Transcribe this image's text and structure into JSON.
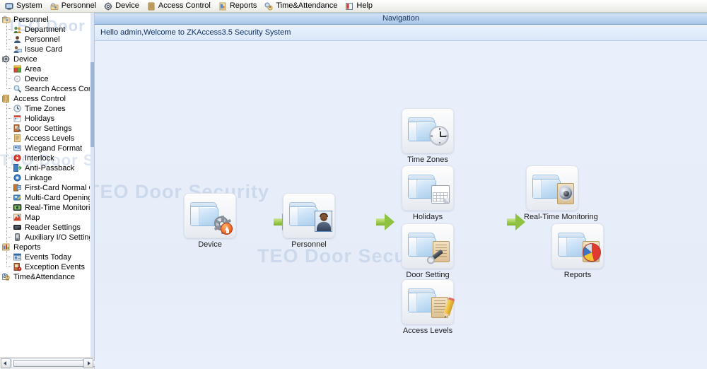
{
  "app": {
    "watermark": "TEO Door Security"
  },
  "menubar": {
    "items": [
      {
        "label": "System",
        "icon": "monitor-icon"
      },
      {
        "label": "Personnel",
        "icon": "personnel-icon"
      },
      {
        "label": "Device",
        "icon": "gear-icon"
      },
      {
        "label": "Access Control",
        "icon": "door-icon"
      },
      {
        "label": "Reports",
        "icon": "report-icon"
      },
      {
        "label": "Time&Attendance",
        "icon": "clock-people-icon"
      },
      {
        "label": "Help",
        "icon": "help-book-icon"
      }
    ]
  },
  "sidebar": {
    "nodes": [
      {
        "label": "Personnel",
        "level": 0,
        "icon": "personnel-folder-icon",
        "expanded": true
      },
      {
        "label": "Department",
        "level": 1,
        "icon": "department-icon"
      },
      {
        "label": "Personnel",
        "level": 1,
        "icon": "person-icon"
      },
      {
        "label": "Issue Card",
        "level": 1,
        "icon": "issue-card-icon"
      },
      {
        "label": "Device",
        "level": 0,
        "icon": "gear-icon",
        "expanded": true
      },
      {
        "label": "Area",
        "level": 1,
        "icon": "area-icon"
      },
      {
        "label": "Device",
        "level": 1,
        "icon": "device-gear-icon"
      },
      {
        "label": "Search Access Contro",
        "level": 1,
        "icon": "search-icon"
      },
      {
        "label": "Access Control",
        "level": 0,
        "icon": "access-control-folder-icon",
        "expanded": true
      },
      {
        "label": "Time Zones",
        "level": 1,
        "icon": "time-zones-icon"
      },
      {
        "label": "Holidays",
        "level": 1,
        "icon": "holidays-icon"
      },
      {
        "label": "Door Settings",
        "level": 1,
        "icon": "door-settings-icon"
      },
      {
        "label": "Access Levels",
        "level": 1,
        "icon": "access-levels-icon"
      },
      {
        "label": "Wiegand Format",
        "level": 1,
        "icon": "wiegand-icon"
      },
      {
        "label": "Interlock",
        "level": 1,
        "icon": "interlock-icon"
      },
      {
        "label": "Anti-Passback",
        "level": 1,
        "icon": "anti-passback-icon"
      },
      {
        "label": "Linkage",
        "level": 1,
        "icon": "linkage-icon"
      },
      {
        "label": "First-Card Normal Op",
        "level": 1,
        "icon": "first-card-icon"
      },
      {
        "label": "Multi-Card Opening",
        "level": 1,
        "icon": "multi-card-icon"
      },
      {
        "label": "Real-Time Monitoring",
        "level": 1,
        "icon": "monitoring-icon"
      },
      {
        "label": "Map",
        "level": 1,
        "icon": "map-icon"
      },
      {
        "label": "Reader Settings",
        "level": 1,
        "icon": "reader-icon"
      },
      {
        "label": "Auxiliary I/O Settings",
        "level": 1,
        "icon": "auxiliary-io-icon"
      },
      {
        "label": "Reports",
        "level": 0,
        "icon": "reports-folder-icon",
        "expanded": true
      },
      {
        "label": "Events Today",
        "level": 1,
        "icon": "events-today-icon"
      },
      {
        "label": "Exception Events",
        "level": 1,
        "icon": "exception-events-icon"
      },
      {
        "label": "Time&Attendance",
        "level": 0,
        "icon": "time-attendance-icon",
        "expanded": false
      }
    ]
  },
  "navbar": {
    "title": "Navigation"
  },
  "welcome": {
    "text": "Hello admin,Welcome to ZKAccess3.5 Security System"
  },
  "flow": {
    "tiles": [
      {
        "key": "device",
        "label": "Device",
        "icon": "folder-gear-upload-icon"
      },
      {
        "key": "personnel",
        "label": "Personnel",
        "icon": "folder-person-icon"
      },
      {
        "key": "time_zones",
        "label": "Time Zones",
        "icon": "folder-clock-icon"
      },
      {
        "key": "holidays",
        "label": "Holidays",
        "icon": "folder-calendar-icon"
      },
      {
        "key": "door_setting",
        "label": "Door Setting",
        "icon": "folder-wrench-icon"
      },
      {
        "key": "access_levels",
        "label": "Access Levels",
        "icon": "folder-pencil-icon"
      },
      {
        "key": "real_time_monitoring",
        "label": "Real-Time Monitoring",
        "icon": "folder-camera-icon"
      },
      {
        "key": "reports",
        "label": "Reports",
        "icon": "folder-pie-icon"
      }
    ],
    "arrows": [
      "arrow-right-1",
      "arrow-right-2",
      "arrow-right-3"
    ]
  },
  "colors": {
    "accent": "#a8c6e9",
    "canvas": "#e9f0fb",
    "arrow_green": "#8dc341",
    "watermark": "#c3d2e8"
  }
}
